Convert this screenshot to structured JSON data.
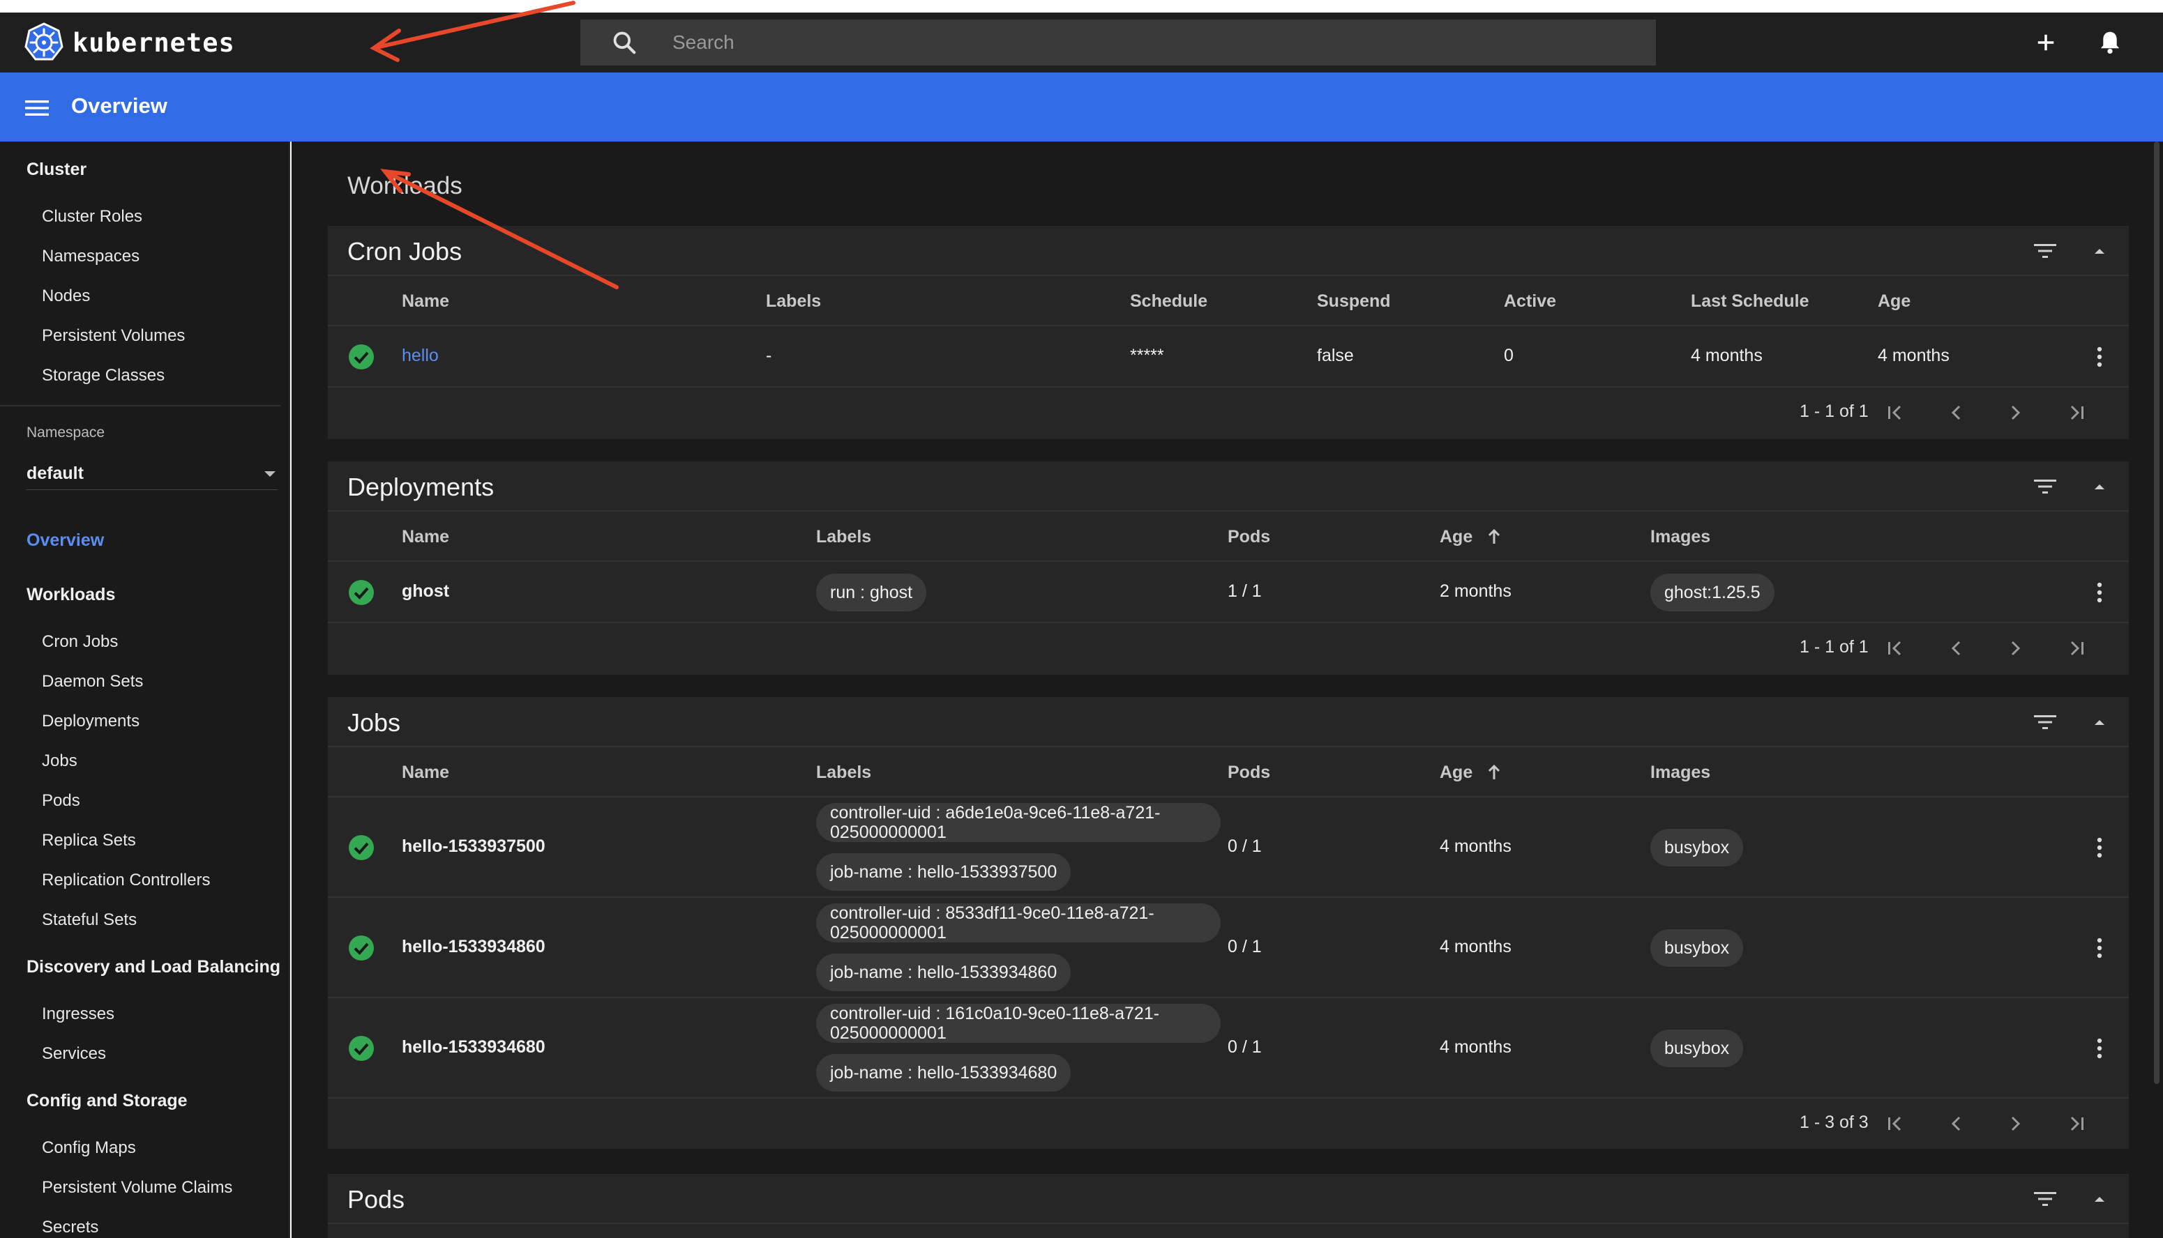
{
  "app": {
    "brand": "kubernetes",
    "page_title": "Overview",
    "search_placeholder": "Search"
  },
  "icons": {
    "logo": "kubernetes-logo",
    "search": "search-icon",
    "create": "plus-icon",
    "notifications": "bell-icon",
    "menu": "hamburger-menu-icon",
    "filter": "filter-icon",
    "collapse": "caret-up-icon",
    "more": "more-vertical-icon",
    "status_ok": "check-circle-icon"
  },
  "colors": {
    "accent": "#326ce5",
    "link": "#5a8ef0",
    "success": "#34a853",
    "annotation": "#e8472a"
  },
  "sidebar": {
    "cluster_header": "Cluster",
    "cluster_items": [
      "Cluster Roles",
      "Namespaces",
      "Nodes",
      "Persistent Volumes",
      "Storage Classes"
    ],
    "namespace_label": "Namespace",
    "namespace_value": "default",
    "overview": "Overview",
    "workloads_header": "Workloads",
    "workloads_items": [
      "Cron Jobs",
      "Daemon Sets",
      "Deployments",
      "Jobs",
      "Pods",
      "Replica Sets",
      "Replication Controllers",
      "Stateful Sets"
    ],
    "discovery_header": "Discovery and Load Balancing",
    "discovery_items": [
      "Ingresses",
      "Services"
    ],
    "config_header": "Config and Storage",
    "config_items": [
      "Config Maps",
      "Persistent Volume Claims",
      "Secrets"
    ]
  },
  "main": {
    "section_title": "Workloads",
    "cron_jobs": {
      "title": "Cron Jobs",
      "columns": [
        "Name",
        "Labels",
        "Schedule",
        "Suspend",
        "Active",
        "Last Schedule",
        "Age"
      ],
      "rows": [
        {
          "name": "hello",
          "labels": "-",
          "schedule": "*****",
          "suspend": "false",
          "active": "0",
          "last_schedule": "4 months",
          "age": "4 months"
        }
      ],
      "pagination": "1 - 1 of 1"
    },
    "deployments": {
      "title": "Deployments",
      "columns": [
        "Name",
        "Labels",
        "Pods",
        "Age",
        "Images"
      ],
      "rows": [
        {
          "name": "ghost",
          "label": "run : ghost",
          "pods": "1 / 1",
          "age": "2 months",
          "image": "ghost:1.25.5"
        }
      ],
      "pagination": "1 - 1 of 1"
    },
    "jobs": {
      "title": "Jobs",
      "columns": [
        "Name",
        "Labels",
        "Pods",
        "Age",
        "Images"
      ],
      "rows": [
        {
          "name": "hello-1533937500",
          "label_uid": "controller-uid : a6de1e0a-9ce6-11e8-a721-025000000001",
          "label_job": "job-name : hello-1533937500",
          "pods": "0 / 1",
          "age": "4 months",
          "image": "busybox"
        },
        {
          "name": "hello-1533934860",
          "label_uid": "controller-uid : 8533df11-9ce0-11e8-a721-025000000001",
          "label_job": "job-name : hello-1533934860",
          "pods": "0 / 1",
          "age": "4 months",
          "image": "busybox"
        },
        {
          "name": "hello-1533934680",
          "label_uid": "controller-uid : 161c0a10-9ce0-11e8-a721-025000000001",
          "label_job": "job-name : hello-1533934680",
          "pods": "0 / 1",
          "age": "4 months",
          "image": "busybox"
        }
      ],
      "pagination": "1 - 3 of 3"
    },
    "pods": {
      "title": "Pods"
    }
  }
}
